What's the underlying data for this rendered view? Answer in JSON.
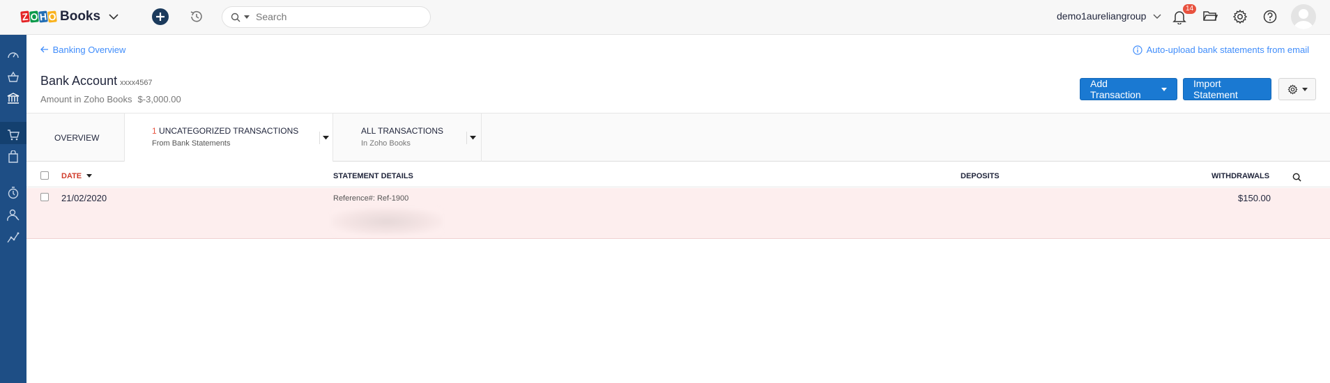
{
  "app": {
    "logo_letters": [
      "Z",
      "O",
      "H",
      "O"
    ],
    "logo_colors": [
      "#e42527",
      "#089949",
      "#226db4",
      "#f9b21d"
    ],
    "product_name": "Books"
  },
  "topbar": {
    "search_placeholder": "Search",
    "org_name": "demo1aureliangroup",
    "notification_count": "14"
  },
  "page": {
    "back_link": "Banking Overview",
    "auto_upload_link": "Auto-upload bank statements from email",
    "title": "Bank Account",
    "account_number": "xxxx4567",
    "amount_label": "Amount in Zoho Books",
    "amount_value": "$-3,000.00",
    "add_transaction_label": "Add Transaction",
    "import_statement_label": "Import Statement"
  },
  "tabs": {
    "overview": "OVERVIEW",
    "uncategorized_count": "1",
    "uncategorized_label": "UNCATEGORIZED TRANSACTIONS",
    "uncategorized_sub": "From Bank Statements",
    "all_label": "ALL TRANSACTIONS",
    "all_sub": "In Zoho Books"
  },
  "table": {
    "columns": {
      "date": "DATE",
      "details": "STATEMENT DETAILS",
      "deposits": "DEPOSITS",
      "withdrawals": "WITHDRAWALS"
    },
    "rows": [
      {
        "date": "21/02/2020",
        "reference": "Reference#: Ref-1900",
        "deposit": "",
        "withdrawal": "$150.00"
      }
    ]
  },
  "colors": {
    "sidebar": "#1e4e85",
    "primary_button": "#1a79d2",
    "link": "#408dfb",
    "row_highlight": "#fdeeee",
    "accent_red": "#d03c2b"
  },
  "icons": {
    "sidebar": [
      "dashboard-icon",
      "items-basket-icon",
      "banking-icon",
      "sales-cart-icon",
      "purchases-bag-icon",
      "time-tracking-icon",
      "accountant-icon",
      "reports-icon"
    ]
  }
}
